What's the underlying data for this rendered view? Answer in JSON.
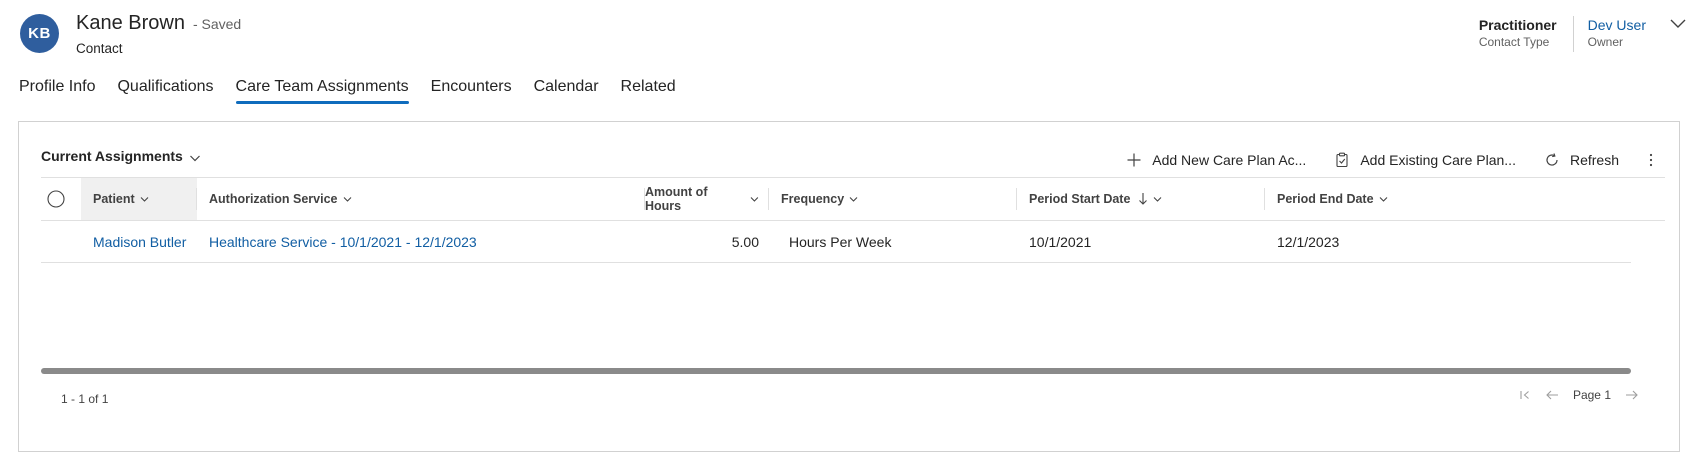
{
  "header": {
    "avatar_initials": "KB",
    "avatar_color": "#2f5e9e",
    "record_name": "Kane Brown",
    "save_status": "- Saved",
    "entity_type": "Contact",
    "fields": [
      {
        "value": "Practitioner",
        "label": "Contact Type"
      },
      {
        "value": "Dev User",
        "label": "Owner"
      }
    ],
    "expand_icon": "chevron-down-icon"
  },
  "tabs": [
    {
      "label": "Profile Info",
      "active": false
    },
    {
      "label": "Qualifications",
      "active": false
    },
    {
      "label": "Care Team Assignments",
      "active": true
    },
    {
      "label": "Encounters",
      "active": false
    },
    {
      "label": "Calendar",
      "active": false
    },
    {
      "label": "Related",
      "active": false
    }
  ],
  "grid": {
    "view_name": "Current Assignments",
    "commands": [
      {
        "label": "Add New Care Plan Ac...",
        "icon": "plus-icon"
      },
      {
        "label": "Add Existing Care Plan...",
        "icon": "clipboard-icon"
      },
      {
        "label": "Refresh",
        "icon": "refresh-icon"
      }
    ],
    "more_icon": "more-vertical-icon",
    "columns": [
      {
        "label": "Patient"
      },
      {
        "label": "Authorization Service"
      },
      {
        "label": "Amount of Hours"
      },
      {
        "label": "Frequency"
      },
      {
        "label": "Period Start Date"
      },
      {
        "label": "Period End Date"
      }
    ],
    "rows": [
      {
        "patient": "Madison Butler",
        "authorization_service": "Healthcare Service - 10/1/2021 - 12/1/2023",
        "amount_of_hours": "5.00",
        "frequency": "Hours Per Week",
        "period_start_date": "10/1/2021",
        "period_end_date": "12/1/2023"
      }
    ],
    "record_count": "1 - 1 of 1",
    "page_label": "Page 1"
  },
  "colors": {
    "accent": "#0f6cbd",
    "link": "#115ea3"
  }
}
